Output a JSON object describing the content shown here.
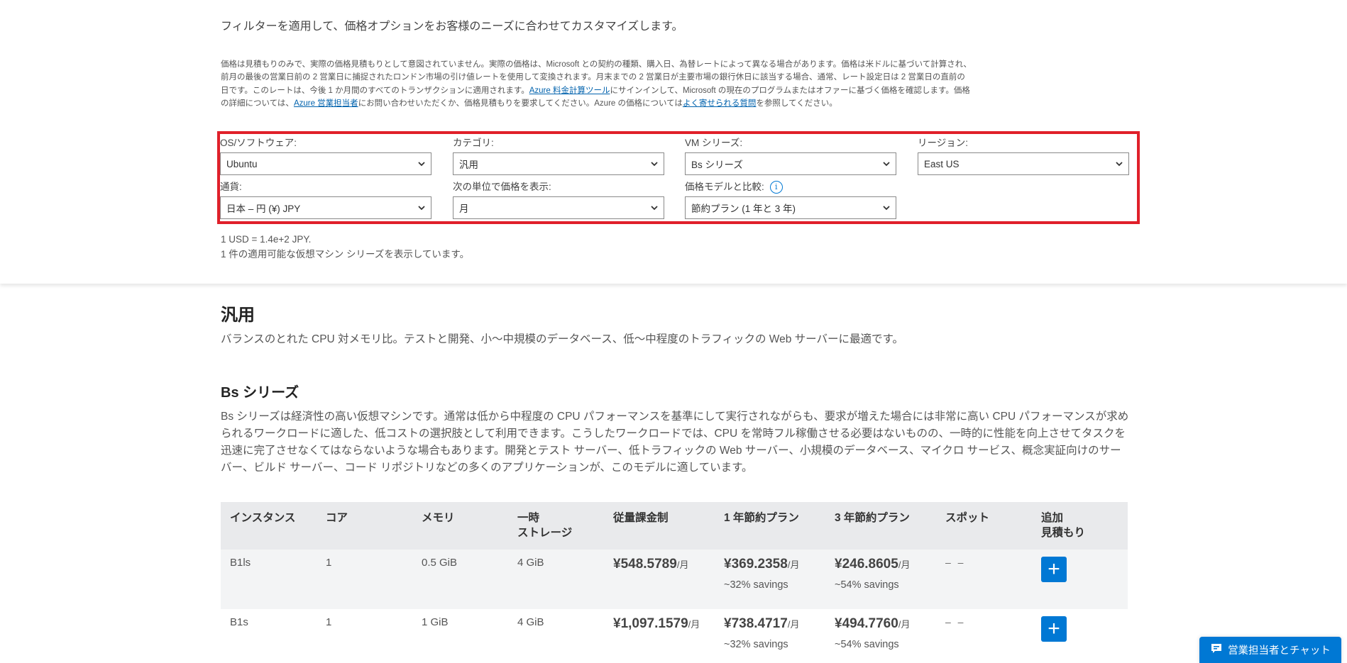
{
  "intro": "フィルターを適用して、価格オプションをお客様のニーズに合わせてカスタマイズします。",
  "disclaimer": {
    "part1": "価格は見積もりのみで、実際の価格見積もりとして意図されていません。実際の価格は、Microsoft との契約の種類、購入日、為替レートによって異なる場合があります。価格は米ドルに基づいて計算され、前月の最後の営業日前の 2 営業日に捕捉されたロンドン市場の引け値レートを使用して変換されます。月末までの 2 営業日が主要市場の銀行休日に該当する場合、通常、レート設定日は 2 営業日の直前の日です。このレートは、今後 1 か月間のすべてのトランザクションに適用されます。",
    "link1": "Azure 料金計算ツール",
    "part2": "にサインインして、Microsoft の現在のプログラムまたはオファーに基づく価格を確認します。価格の詳細については、",
    "link2": "Azure 営業担当者",
    "part3": "にお問い合わせいただくか、価格見積もりを要求してください。Azure の価格については",
    "link3": "よく寄せられる質問",
    "part4": "を参照してください。"
  },
  "filters": {
    "os": {
      "label": "OS/ソフトウェア:",
      "value": "Ubuntu"
    },
    "category": {
      "label": "カテゴリ:",
      "value": "汎用"
    },
    "vm_series": {
      "label": "VM シリーズ:",
      "value": "Bs シリーズ"
    },
    "region": {
      "label": "リージョン:",
      "value": "East US"
    },
    "currency": {
      "label": "通貨:",
      "value": "日本 – 円 (¥) JPY"
    },
    "display_unit": {
      "label": "次の単位で価格を表示:",
      "value": "月"
    },
    "pricing_model": {
      "label": "価格モデルと比較:",
      "value": "節約プラン (1 年と 3 年)",
      "info_icon": "info-icon"
    }
  },
  "exchange_rate": "1 USD = 1.4e+2 JPY.",
  "result_count": "1 件の適用可能な仮想マシン シリーズを表示しています。",
  "category_section": {
    "title": "汎用",
    "description": "バランスのとれた CPU 対メモリ比。テストと開発、小～中規模のデータベース、低～中程度のトラフィックの Web サーバーに最適です。"
  },
  "series_section": {
    "title": "Bs シリーズ",
    "description": "Bs シリーズは経済性の高い仮想マシンです。通常は低から中程度の CPU パフォーマンスを基準にして実行されながらも、要求が増えた場合には非常に高い CPU パフォーマンスが求められるワークロードに適した、低コストの選択肢として利用できます。こうしたワークロードでは、CPU を常時フル稼働させる必要はないものの、一時的に性能を向上させてタスクを迅速に完了させなくてはならないような場合もあります。開発とテスト サーバー、低トラフィックの Web サーバー、小規模のデータベース、マイクロ サービス、概念実証向けのサーバー、ビルド サーバー、コード リポジトリなどの多くのアプリケーションが、このモデルに適しています。"
  },
  "table": {
    "headers": {
      "instance": "インスタンス",
      "cores": "コア",
      "memory": "メモリ",
      "storage_1": "一時",
      "storage_2": "ストレージ",
      "payg": "従量課金制",
      "sp1": "1 年節約プラン",
      "sp3": "3 年節約プラン",
      "spot": "スポット",
      "add_1": "追加",
      "add_2": "見積もり"
    },
    "unit": "/月",
    "rows": [
      {
        "instance": "B1ls",
        "cores": "1",
        "memory": "0.5 GiB",
        "storage": "4 GiB",
        "payg": "¥548.5789",
        "sp1": "¥369.2358",
        "sp1_savings": "~32% savings",
        "sp3": "¥246.8605",
        "sp3_savings": "~54% savings",
        "spot": "– –",
        "add": "+"
      },
      {
        "instance": "B1s",
        "cores": "1",
        "memory": "1 GiB",
        "storage": "4 GiB",
        "payg": "¥1,097.1579",
        "sp1": "¥738.4717",
        "sp1_savings": "~32% savings",
        "sp3": "¥494.7760",
        "sp3_savings": "~54% savings",
        "spot": "– –",
        "add": "+"
      }
    ]
  },
  "chat_button": {
    "label": "営業担当者とチャット",
    "icon": "chat-icon"
  },
  "colors": {
    "accent": "#0078d4",
    "highlight_border": "#e0202a",
    "link": "#0062ad"
  }
}
